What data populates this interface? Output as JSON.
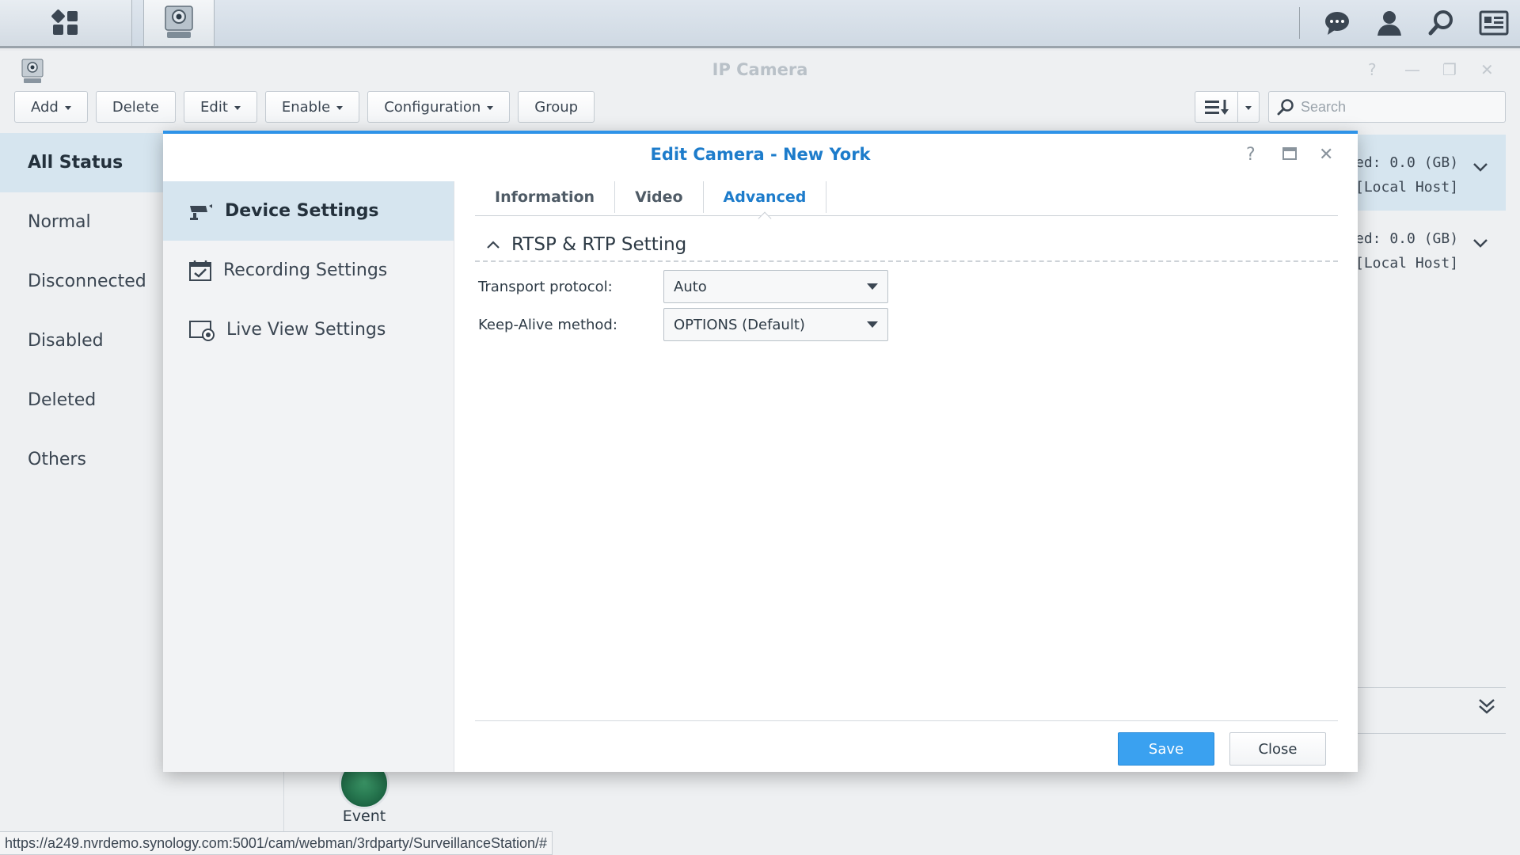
{
  "app": {
    "title": "IP Camera"
  },
  "toolbar": {
    "add": "Add",
    "delete": "Delete",
    "edit": "Edit",
    "enable": "Enable",
    "configuration": "Configuration",
    "group": "Group"
  },
  "search": {
    "placeholder": "Search"
  },
  "status_list": {
    "items": [
      {
        "label": "All Status"
      },
      {
        "label": "Normal"
      },
      {
        "label": "Disconnected"
      },
      {
        "label": "Disabled"
      },
      {
        "label": "Deleted"
      },
      {
        "label": "Others"
      }
    ]
  },
  "camera_rows": [
    {
      "line1": "ed: 0.0 (GB)",
      "line2": "[Local Host]"
    },
    {
      "line1": "ed: 0.0 (GB)",
      "line2": "[Local Host]"
    }
  ],
  "event": {
    "label": "Event"
  },
  "statusbar": {
    "url": "https://a249.nvrdemo.synology.com:5001/cam/webman/3rdparty/SurveillanceStation/#"
  },
  "dialog": {
    "title": "Edit Camera - New York",
    "sidebar": [
      {
        "label": "Device Settings",
        "icon": "camera-icon"
      },
      {
        "label": "Recording Settings",
        "icon": "calendar-check-icon"
      },
      {
        "label": "Live View Settings",
        "icon": "live-view-icon"
      }
    ],
    "tabs": [
      {
        "label": "Information"
      },
      {
        "label": "Video"
      },
      {
        "label": "Advanced"
      }
    ],
    "active_tab": "Advanced",
    "section_title": "RTSP & RTP Setting",
    "transport": {
      "label": "Transport protocol:",
      "value": "Auto"
    },
    "keepalive": {
      "label": "Keep-Alive method:",
      "value": "OPTIONS (Default)"
    },
    "save": "Save",
    "close": "Close"
  },
  "colors": {
    "accent": "#1d7ccb",
    "primary_button": "#3aa1f0",
    "selected_row": "#d6e5ef"
  }
}
